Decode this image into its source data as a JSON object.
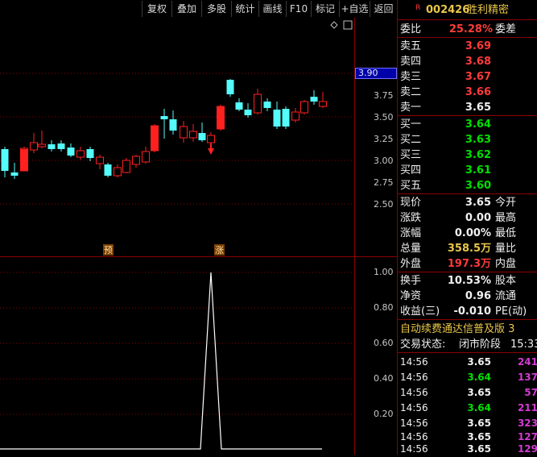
{
  "toolbar": {
    "buttons": [
      "复权",
      "叠加",
      "多股",
      "统计",
      "画线",
      "F10",
      "标记",
      "+自选",
      "返回"
    ]
  },
  "main_axis": {
    "ticks": [
      "3.75",
      "3.50",
      "3.25",
      "3.00",
      "2.75",
      "2.50"
    ],
    "current_price_tag": "3.90"
  },
  "indicator_axis": {
    "ticks": [
      "1.00",
      "0.80",
      "0.60",
      "0.40",
      "0.20"
    ]
  },
  "markers": {
    "pre": "预",
    "rise": "涨"
  },
  "colors": {
    "up": "#ff2020",
    "down": "#54fcfc",
    "grid": "#8b0000",
    "axis_text": "#c8c8c8"
  },
  "stock": {
    "badge": "R",
    "code": "002426",
    "name": "胜利精密"
  },
  "commission": {
    "label": "委比",
    "value": "25.28%",
    "label2": "委差"
  },
  "asks": [
    {
      "label": "卖五",
      "price": "3.69"
    },
    {
      "label": "卖四",
      "price": "3.68"
    },
    {
      "label": "卖三",
      "price": "3.67"
    },
    {
      "label": "卖二",
      "price": "3.66"
    },
    {
      "label": "卖一",
      "price": "3.65"
    }
  ],
  "bids": [
    {
      "label": "买一",
      "price": "3.64"
    },
    {
      "label": "买二",
      "price": "3.63"
    },
    {
      "label": "买三",
      "price": "3.62"
    },
    {
      "label": "买四",
      "price": "3.61"
    },
    {
      "label": "买五",
      "price": "3.60"
    }
  ],
  "quote": [
    {
      "label": "现价",
      "value": "3.65",
      "label2": "今开"
    },
    {
      "label": "涨跌",
      "value": "0.00",
      "label2": "最高"
    },
    {
      "label": "涨幅",
      "value": "0.00%",
      "label2": "最低"
    },
    {
      "label": "总量",
      "value": "358.5万",
      "label2": "量比"
    },
    {
      "label": "外盘",
      "value": "197.3万",
      "label2": "内盘"
    }
  ],
  "finance": [
    {
      "label": "换手",
      "value": "10.53%",
      "label2": "股本"
    },
    {
      "label": "净资",
      "value": "0.96",
      "label2": "流通"
    },
    {
      "label": "收益(三)",
      "value": "-0.010",
      "label2": "PE(动)"
    }
  ],
  "notice": "自动续费通达信普及版 3",
  "trade_status": {
    "label": "交易状态:",
    "value": "闭市阶段",
    "time": "15:33"
  },
  "ticks": [
    {
      "time": "14:56",
      "price": "3.65",
      "vol": "241"
    },
    {
      "time": "14:56",
      "price": "3.64",
      "vol": "137"
    },
    {
      "time": "14:56",
      "price": "3.65",
      "vol": "57"
    },
    {
      "time": "14:56",
      "price": "3.64",
      "vol": "211"
    },
    {
      "time": "14:56",
      "price": "3.65",
      "vol": "323"
    },
    {
      "time": "14:56",
      "price": "3.65",
      "vol": "127"
    },
    {
      "time": "14:56",
      "price": "3.65",
      "vol": "129"
    }
  ]
}
